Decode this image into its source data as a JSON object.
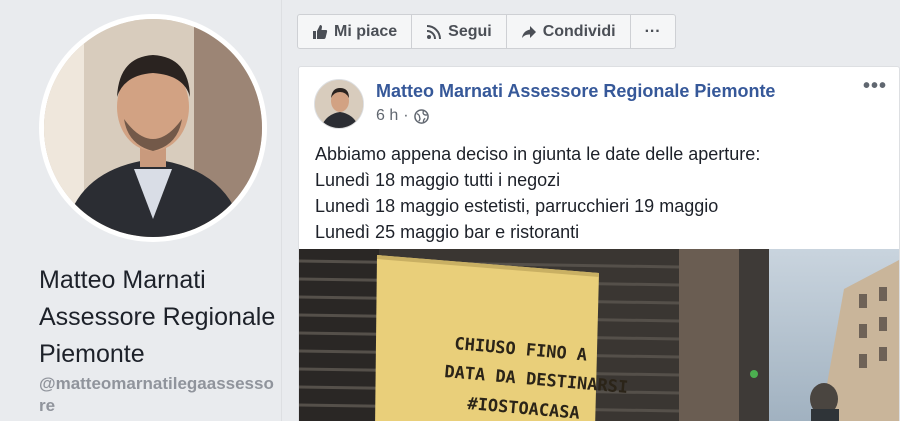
{
  "profile": {
    "name": "Matteo Marnati Assessore Regionale Piemonte",
    "handle": "@matteomarnatilegaassessore"
  },
  "actions": [
    {
      "label": "Mi piace",
      "icon": "thumbs-up-icon"
    },
    {
      "label": "Segui",
      "icon": "rss-icon"
    },
    {
      "label": "Condividi",
      "icon": "share-arrow-icon"
    },
    {
      "label": "···",
      "icon": "more-icon"
    }
  ],
  "post": {
    "author": "Matteo Marnati Assessore Regionale Piemonte",
    "time": "6 h",
    "separator": "·",
    "privacy_icon": "globe-icon",
    "menu": "•••",
    "lines": [
      "Abbiamo appena deciso in giunta le date delle aperture:",
      "Lunedì 18 maggio tutti i negozi",
      "Lunedì 18 maggio estetisti, parrucchieri 19 maggio",
      "Lunedì 25 maggio bar e ristoranti"
    ],
    "image_sign": {
      "line1": "CHIUSO FINO A",
      "line2": "DATA DA DESTINARSI",
      "line3": "#IOSTOACASA"
    }
  }
}
